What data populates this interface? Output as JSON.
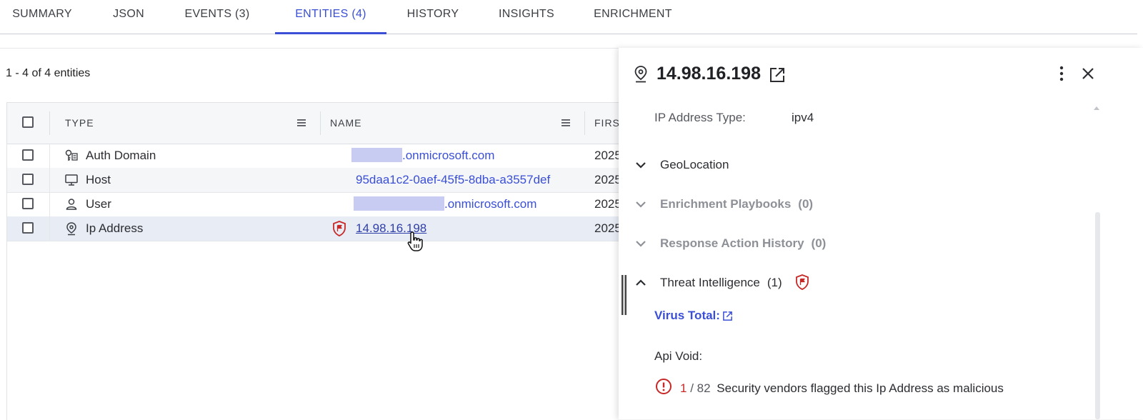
{
  "tabs": [
    {
      "label": "SUMMARY",
      "active": false
    },
    {
      "label": "JSON",
      "active": false
    },
    {
      "label": "EVENTS (3)",
      "active": false
    },
    {
      "label": "ENTITIES (4)",
      "active": true
    },
    {
      "label": "HISTORY",
      "active": false
    },
    {
      "label": "INSIGHTS",
      "active": false
    },
    {
      "label": "ENRICHMENT",
      "active": false
    }
  ],
  "entities": {
    "count_text": "1 - 4 of 4 entities",
    "columns": {
      "type": "TYPE",
      "name": "NAME",
      "first": "FIRST"
    },
    "rows": [
      {
        "type": "Auth Domain",
        "icon": "auth-domain-icon",
        "name_visible": ".onmicrosoft.com",
        "first": "2025"
      },
      {
        "type": "Host",
        "icon": "monitor-icon",
        "name_visible": "95daa1c2-0aef-45f5-8dba-a3557def",
        "first": "2025"
      },
      {
        "type": "User",
        "icon": "user-icon",
        "name_visible": ".onmicrosoft.com",
        "first": "2025"
      },
      {
        "type": "Ip Address",
        "icon": "location-pin-icon",
        "name_visible": "14.98.16.198",
        "first": "2025"
      }
    ]
  },
  "panel": {
    "title": "14.98.16.198",
    "ip_type_label": "IP Address Type:",
    "ip_type_value": "ipv4",
    "sections": {
      "geolocation": "GeoLocation",
      "enrichment_playbooks": "Enrichment Playbooks",
      "enrichment_playbooks_count": "(0)",
      "response_history": "Response Action History",
      "response_history_count": "(0)",
      "threat_intel": "Threat Intelligence",
      "threat_intel_count": "(1)"
    },
    "virus_total_label": "Virus Total:",
    "api_void_label": "Api Void:",
    "flag_count": "1",
    "flag_total": "/ 82",
    "flag_message": "Security vendors flagged this Ip Address as malicious"
  },
  "colors": {
    "accent": "#3a4fd6",
    "danger": "#c62828",
    "muted": "#8d9096"
  }
}
